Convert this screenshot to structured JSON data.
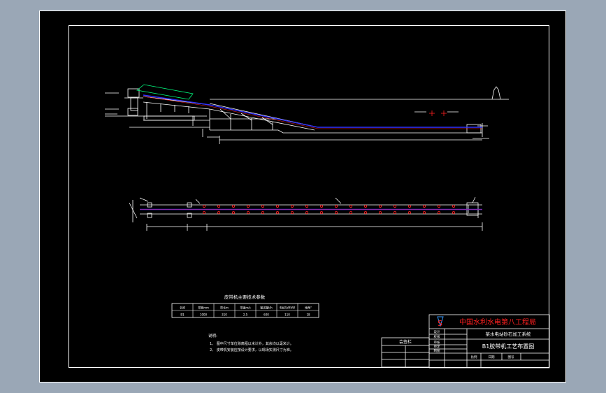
{
  "table": {
    "title": "皮带机主要技术参数",
    "headers": [
      "名称",
      "带宽mm",
      "带长m",
      "带速m/s",
      "输送量t/h",
      "电机功率kW",
      "倾角°"
    ],
    "row": [
      "B1",
      "1000",
      "310",
      "2.5",
      "600",
      "110",
      "18"
    ]
  },
  "notes": {
    "title": "说明:",
    "lines": [
      "1、 图中尺寸单位除高程以米计外，其余均以毫米计。",
      "2、 皮带机安装应按设计要求，以现场实测尺寸为准。"
    ]
  },
  "titleblock": {
    "company": "中国水利水电第八工程局",
    "project": "某水电站砂石加工系统",
    "drawing_title": "B1胶带机工艺布置图",
    "left_label": "会签栏",
    "roles": [
      "设计",
      "校核",
      "审核",
      "审定",
      "制图"
    ],
    "bottom_items": [
      "比例",
      "日期",
      "图号"
    ]
  },
  "colors": {
    "background": "#000000",
    "surround": "#9aa7b6",
    "line": "#ffffff",
    "belt": "#3333ff",
    "belt_center": "#ff2020",
    "logo": "#ff2020",
    "pulley": "#ff2020"
  }
}
